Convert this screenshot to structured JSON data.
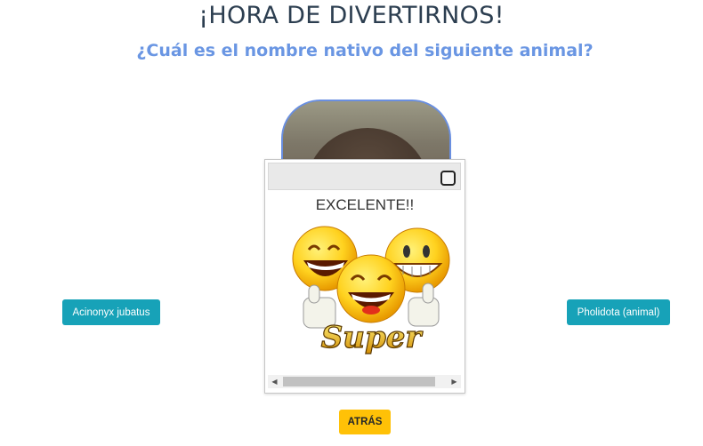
{
  "page": {
    "title": "¡HORA DE DIVERTIRNOS!",
    "question": "¿Cuál es el nombre nativo del siguiente animal?"
  },
  "answers": {
    "left_label": "Acinonyx jubatus",
    "right_label": "Pholidota (animal)"
  },
  "back_button": {
    "label": "ATRÁS"
  },
  "dialog": {
    "message": "EXCELENTE!!",
    "image_text": "Super"
  },
  "colors": {
    "answer_button": "#17a2b8",
    "back_button": "#ffc107",
    "question_text": "#6a96e3",
    "title_text": "#2c3e50"
  }
}
